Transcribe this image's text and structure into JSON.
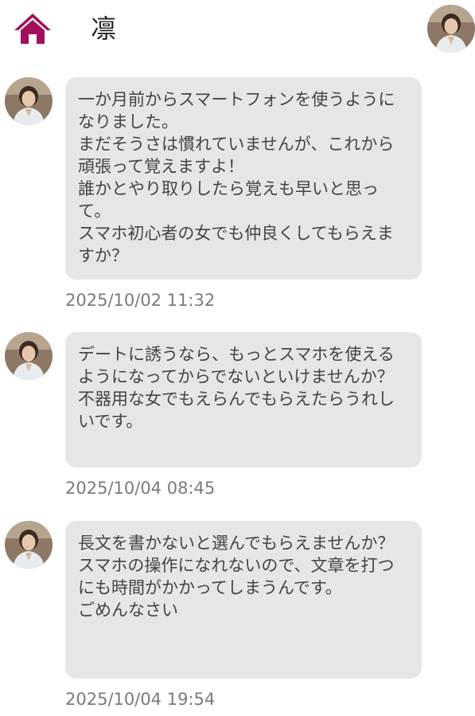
{
  "header": {
    "title": "凛",
    "home_icon": "home-icon",
    "accent_color": "#a0105c"
  },
  "messages": [
    {
      "text": "一か月前からスマートフォンを使うようになりました。\nまだそうさは慣れていませんが、これから頑張って覚えますよ！\n誰かとやり取りしたら覚えも早いと思って。\nスマホ初心者の女でも仲良くしてもらえますか？",
      "timestamp": "2025/10/02 11:32"
    },
    {
      "text": "デートに誘うなら、もっとスマホを使えるようになってからでないといけませんか？\n不器用な女でもえらんでもらえたらうれしいです。",
      "timestamp": "2025/10/04 08:45"
    },
    {
      "text": "長文を書かないと選んでもらえませんか？\nスマホの操作になれないので、文章を打つにも時間がかかってしまうんです。\nごめんなさい",
      "timestamp": "2025/10/04 19:54"
    }
  ]
}
